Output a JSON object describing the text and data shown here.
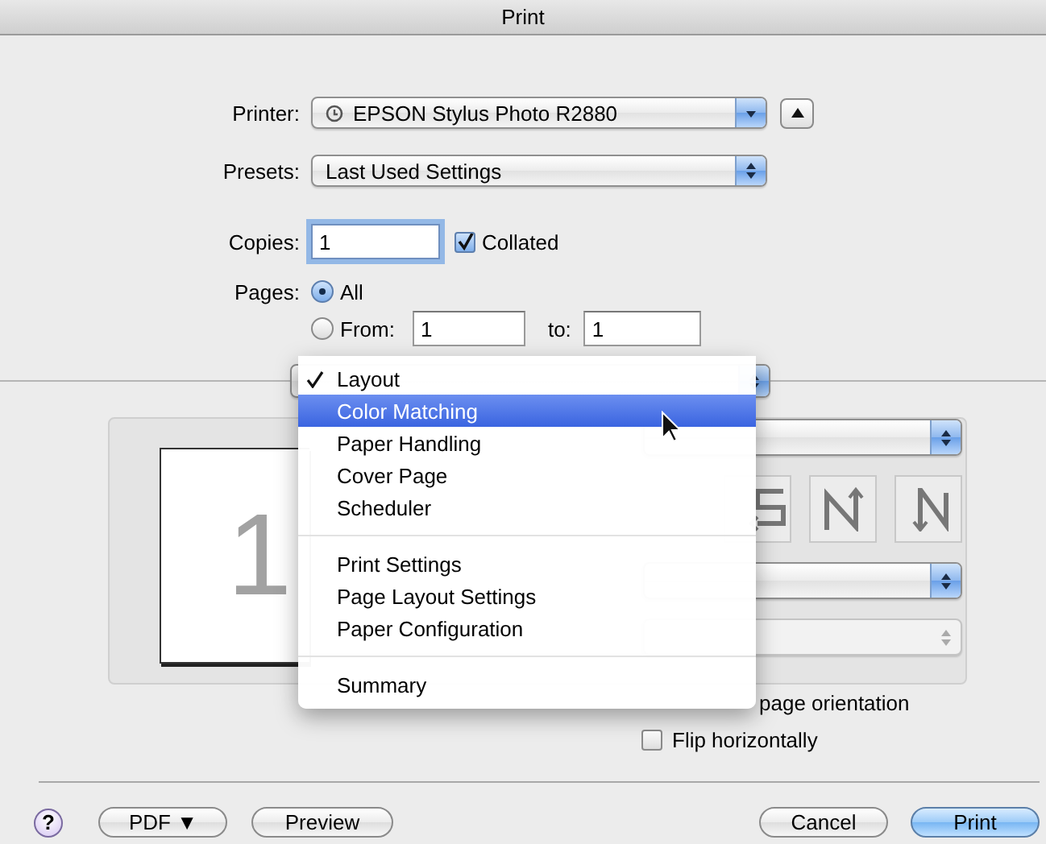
{
  "window": {
    "title": "Print"
  },
  "printer": {
    "label": "Printer:",
    "value": "EPSON Stylus Photo R2880"
  },
  "presets": {
    "label": "Presets:",
    "value": "Last Used Settings"
  },
  "copies": {
    "label": "Copies:",
    "value": "1"
  },
  "collated": {
    "label": "Collated",
    "checked": true
  },
  "pages": {
    "label": "Pages:",
    "options": [
      {
        "label": "All",
        "selected": true
      },
      {
        "label": "From:",
        "selected": false
      }
    ],
    "from": "1",
    "to_label": "to:",
    "to": "1"
  },
  "panel_menu": {
    "groups": [
      [
        {
          "label": "Layout",
          "checked": true,
          "selected": false
        },
        {
          "label": "Color Matching",
          "checked": false,
          "selected": true
        },
        {
          "label": "Paper Handling",
          "checked": false,
          "selected": false
        },
        {
          "label": "Cover Page",
          "checked": false,
          "selected": false
        },
        {
          "label": "Scheduler",
          "checked": false,
          "selected": false
        }
      ],
      [
        {
          "label": "Print Settings",
          "checked": false,
          "selected": false
        },
        {
          "label": "Page Layout Settings",
          "checked": false,
          "selected": false
        },
        {
          "label": "Paper Configuration",
          "checked": false,
          "selected": false
        }
      ],
      [
        {
          "label": "Summary",
          "checked": false,
          "selected": false
        }
      ]
    ]
  },
  "layout": {
    "preview_page": "1",
    "popups": [
      {
        "disabled": false
      },
      {
        "disabled": false
      },
      {
        "disabled": true
      }
    ],
    "options": [
      {
        "kind": "label",
        "label": "page orientation"
      },
      {
        "kind": "checkbox",
        "label": "Flip horizontally",
        "checked": false
      }
    ]
  },
  "help": "?",
  "buttons": [
    {
      "label": "PDF ▼",
      "default": false
    },
    {
      "label": "Preview",
      "default": false
    },
    {
      "label": "Cancel",
      "default": false
    },
    {
      "label": "Print",
      "default": true
    }
  ]
}
